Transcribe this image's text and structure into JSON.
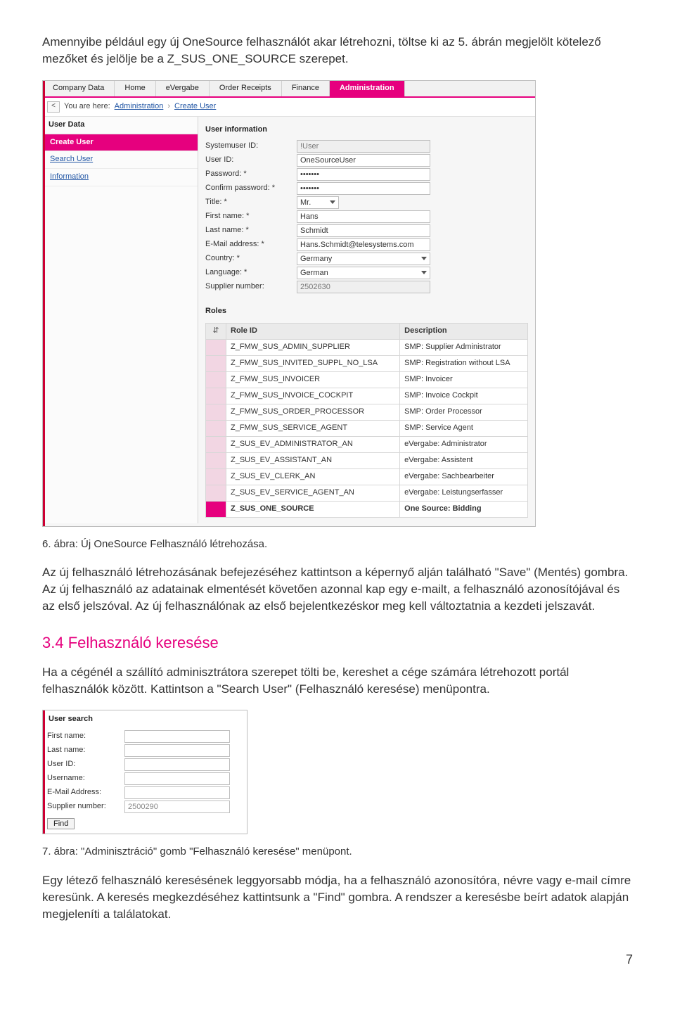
{
  "intro_para": "Amennyibe például egy új OneSource felhasználót akar létrehozni, töltse ki az 5. ábrán megjelölt kötelező mezőket és jelölje be a Z_SUS_ONE_SOURCE szerepet.",
  "shot1": {
    "tabs": [
      "Company Data",
      "Home",
      "eVergabe",
      "Order Receipts",
      "Finance",
      "Administration"
    ],
    "active_tab_index": 5,
    "breadcrumb": {
      "you_are_here": "You are here:",
      "link1": "Administration",
      "sep": "›",
      "link2": "Create User"
    },
    "sidebar": {
      "head": "User Data",
      "items": [
        "Create User",
        "Search User",
        "Information"
      ],
      "active_index": 0
    },
    "user_info": {
      "title": "User information",
      "fields": [
        {
          "label": "Systemuser ID:",
          "value": "!User",
          "readonly": true
        },
        {
          "label": "User ID:",
          "value": "OneSourceUser"
        },
        {
          "label": "Password: *",
          "value": "•••••••"
        },
        {
          "label": "Confirm password: *",
          "value": "•••••••"
        },
        {
          "label": "Title: *",
          "value": "Mr.",
          "dropdown": true,
          "narrow": true
        },
        {
          "label": "First name: *",
          "value": "Hans"
        },
        {
          "label": "Last name: *",
          "value": "Schmidt"
        },
        {
          "label": "E-Mail address: *",
          "value": "Hans.Schmidt@telesystems.com"
        },
        {
          "label": "Country: *",
          "value": "Germany",
          "dropdown": true
        },
        {
          "label": "Language: *",
          "value": "German",
          "dropdown": true
        },
        {
          "label": "Supplier number:",
          "value": "2502630",
          "readonly": true
        }
      ]
    },
    "roles": {
      "title": "Roles",
      "head_icon": "⇵",
      "head_role": "Role ID",
      "head_desc": "Description",
      "rows": [
        {
          "id": "Z_FMW_SUS_ADMIN_SUPPLIER",
          "desc": "SMP: Supplier Administrator"
        },
        {
          "id": "Z_FMW_SUS_INVITED_SUPPL_NO_LSA",
          "desc": "SMP: Registration without LSA"
        },
        {
          "id": "Z_FMW_SUS_INVOICER",
          "desc": "SMP: Invoicer"
        },
        {
          "id": "Z_FMW_SUS_INVOICE_COCKPIT",
          "desc": "SMP: Invoice Cockpit"
        },
        {
          "id": "Z_FMW_SUS_ORDER_PROCESSOR",
          "desc": "SMP: Order Processor"
        },
        {
          "id": "Z_FMW_SUS_SERVICE_AGENT",
          "desc": "SMP: Service Agent"
        },
        {
          "id": "Z_SUS_EV_ADMINISTRATOR_AN",
          "desc": "eVergabe: Administrator"
        },
        {
          "id": "Z_SUS_EV_ASSISTANT_AN",
          "desc": "eVergabe: Assistent"
        },
        {
          "id": "Z_SUS_EV_CLERK_AN",
          "desc": "eVergabe: Sachbearbeiter"
        },
        {
          "id": "Z_SUS_EV_SERVICE_AGENT_AN",
          "desc": "eVergabe: Leistungserfasser"
        },
        {
          "id": "Z_SUS_ONE_SOURCE",
          "desc": "One Source: Bidding",
          "selected": true
        }
      ]
    }
  },
  "caption1": "6. ábra: Új OneSource Felhasználó létrehozása.",
  "para2": "Az új felhasználó létrehozásának befejezéséhez kattintson a képernyő alján található \"Save\" (Mentés) gombra. Az új felhasználó az adatainak elmentését követően azonnal kap egy e-mailt, a felhasználó azonosítójával és az első jelszóval. Az új felhasználónak az első bejelentkezéskor meg kell változtatnia a kezdeti jelszavát.",
  "section_3_4": "3.4 Felhasználó keresése",
  "para3": "Ha a cégénél a szállító adminisztrátora szerepet tölti be, kereshet a cége számára létrehozott portál felhasználók között. Kattintson a \"Search User\" (Felhasználó keresése) menüpontra.",
  "shot2": {
    "title": "User search",
    "fields": [
      {
        "label": "First name:",
        "value": ""
      },
      {
        "label": "Last name:",
        "value": ""
      },
      {
        "label": "User ID:",
        "value": ""
      },
      {
        "label": "Username:",
        "value": ""
      },
      {
        "label": "E-Mail Address:",
        "value": ""
      },
      {
        "label": "Supplier number:",
        "value": "2500290"
      }
    ],
    "button": "Find"
  },
  "caption2": "7. ábra: \"Adminisztráció\" gomb \"Felhasználó keresése\" menüpont.",
  "para4": "Egy létező felhasználó keresésének leggyorsabb módja, ha a felhasználó azonosítóra, névre vagy e-mail címre keresünk. A keresés megkezdéséhez kattintsunk a \"Find\" gombra. A rendszer a keresésbe beírt adatok alapján megjeleníti a találatokat.",
  "page_number": "7"
}
